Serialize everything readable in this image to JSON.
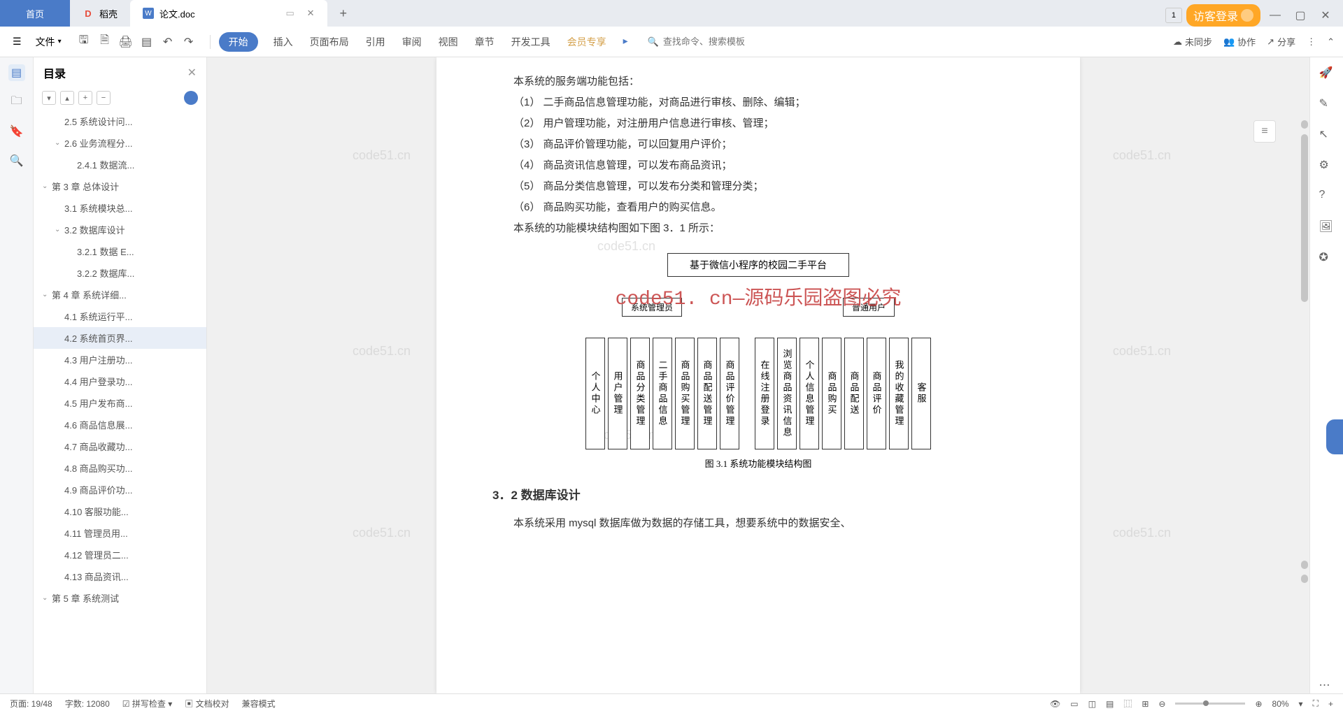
{
  "tabs": {
    "home": "首页",
    "shell": "稻壳",
    "doc": "论文.doc"
  },
  "guest_login": "访客登录",
  "toolbar": {
    "file": "文件",
    "ribbon": [
      "开始",
      "插入",
      "页面布局",
      "引用",
      "审阅",
      "视图",
      "章节",
      "开发工具",
      "会员专享"
    ],
    "search_placeholder": "查找命令、搜索模板",
    "unsync": "未同步",
    "coop": "协作",
    "share": "分享"
  },
  "toc": {
    "title": "目录",
    "items": [
      {
        "lvl": 2,
        "txt": "2.5 系统设计问..."
      },
      {
        "lvl": 2,
        "txt": "2.6 业务流程分...",
        "exp": true
      },
      {
        "lvl": 3,
        "txt": "2.4.1 数据流..."
      },
      {
        "lvl": 1,
        "txt": "第 3 章 总体设计",
        "exp": true
      },
      {
        "lvl": 2,
        "txt": "3.1 系统模块总..."
      },
      {
        "lvl": 2,
        "txt": "3.2 数据库设计",
        "exp": true
      },
      {
        "lvl": 3,
        "txt": "3.2.1 数据 E..."
      },
      {
        "lvl": 3,
        "txt": "3.2.2 数据库..."
      },
      {
        "lvl": 1,
        "txt": "第 4 章   系统详细...",
        "exp": true
      },
      {
        "lvl": 2,
        "txt": "4.1 系统运行平..."
      },
      {
        "lvl": 2,
        "txt": "4.2 系统首页界...",
        "sel": true
      },
      {
        "lvl": 2,
        "txt": "4.3 用户注册功..."
      },
      {
        "lvl": 2,
        "txt": "4.4 用户登录功..."
      },
      {
        "lvl": 2,
        "txt": "4.5 用户发布商..."
      },
      {
        "lvl": 2,
        "txt": "4.6 商品信息展..."
      },
      {
        "lvl": 2,
        "txt": "4.7 商品收藏功..."
      },
      {
        "lvl": 2,
        "txt": "4.8 商品购买功..."
      },
      {
        "lvl": 2,
        "txt": "4.9 商品评价功..."
      },
      {
        "lvl": 2,
        "txt": "4.10 客服功能..."
      },
      {
        "lvl": 2,
        "txt": "4.11 管理员用..."
      },
      {
        "lvl": 2,
        "txt": "4.12 管理员二..."
      },
      {
        "lvl": 2,
        "txt": "4.13 商品资讯..."
      },
      {
        "lvl": 1,
        "txt": "第 5 章   系统测试",
        "exp": true
      }
    ]
  },
  "doc": {
    "line0": "本系统的服务端功能包括：",
    "lines": [
      "（1） 二手商品信息管理功能，对商品进行审核、删除、编辑；",
      "（2） 用户管理功能，对注册用户信息进行审核、管理；",
      "（3） 商品评价管理功能，可以回复用户评价；",
      "（4） 商品资讯信息管理，可以发布商品资讯；",
      "（5） 商品分类信息管理，可以发布分类和管理分类；",
      "（6） 商品购买功能，查看用户的购买信息。"
    ],
    "line7": "本系统的功能模块结构图如下图 3．1 所示：",
    "h3": "3．2 数据库设计",
    "bottom": "本系统采用 mysql 数据库做为数据的存储工具，想要系统中的数据安全、"
  },
  "diagram": {
    "root": "基于微信小程序的校园二手平台",
    "mid": [
      "系统管理员",
      "普通用户"
    ],
    "leaves_left": [
      "个人中心",
      "用户管理",
      "商品分类管理",
      "二手商品信息",
      "商品购买管理",
      "商品配送管理",
      "商品评价管理"
    ],
    "leaves_right": [
      "在线注册登录",
      "浏览商品资讯信息",
      "个人信息管理",
      "商品购买",
      "商品配送",
      "商品评价",
      "我的收藏管理",
      "客服"
    ],
    "caption": "图 3.1 系统功能模块结构图",
    "overlay": "code51. cn—源码乐园盗图必究"
  },
  "watermark": "code51.cn",
  "status": {
    "page": "页面: 19/48",
    "words": "字数: 12080",
    "spell": "拼写检查",
    "proof": "文档校对",
    "compat": "兼容模式",
    "zoom": "80%"
  }
}
